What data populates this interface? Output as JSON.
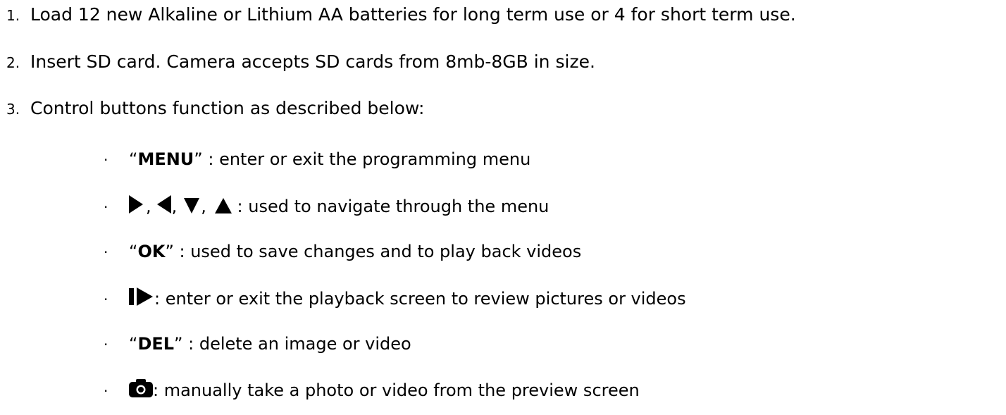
{
  "steps": [
    {
      "number": "1.",
      "text": "Load 12 new Alkaline or Lithium AA batteries for long term use or 4 for short term use."
    },
    {
      "number": "2.",
      "text": "Insert SD card. Camera accepts SD cards from 8mb-8GB in size."
    },
    {
      "number": "3.",
      "text": "Control buttons function as described below:"
    }
  ],
  "bullet": "·",
  "controls": {
    "menu": {
      "open_quote": "“",
      "key": "MENU",
      "close_quote": "”",
      "desc": " : enter or exit the programming menu"
    },
    "arrows": {
      "sep1": ",",
      "sep2": ",",
      "sep3": ",",
      "desc": " : used to navigate through the menu",
      "icons": [
        "arrow-right-icon",
        "arrow-left-icon",
        "arrow-down-icon",
        "arrow-up-icon"
      ]
    },
    "ok": {
      "open_quote": "“",
      "key": "OK",
      "close_quote": "”",
      "desc": " : used to save changes and to play back videos"
    },
    "playback": {
      "desc": ": enter or exit the playback screen to review pictures or videos",
      "icon": "playback-icon"
    },
    "del": {
      "open_quote": "“",
      "key": "DEL",
      "close_quote": "”",
      "desc": " : delete an image or video"
    },
    "camera": {
      "desc": ": manually take a photo or video from the preview screen",
      "icon": "camera-icon"
    }
  }
}
